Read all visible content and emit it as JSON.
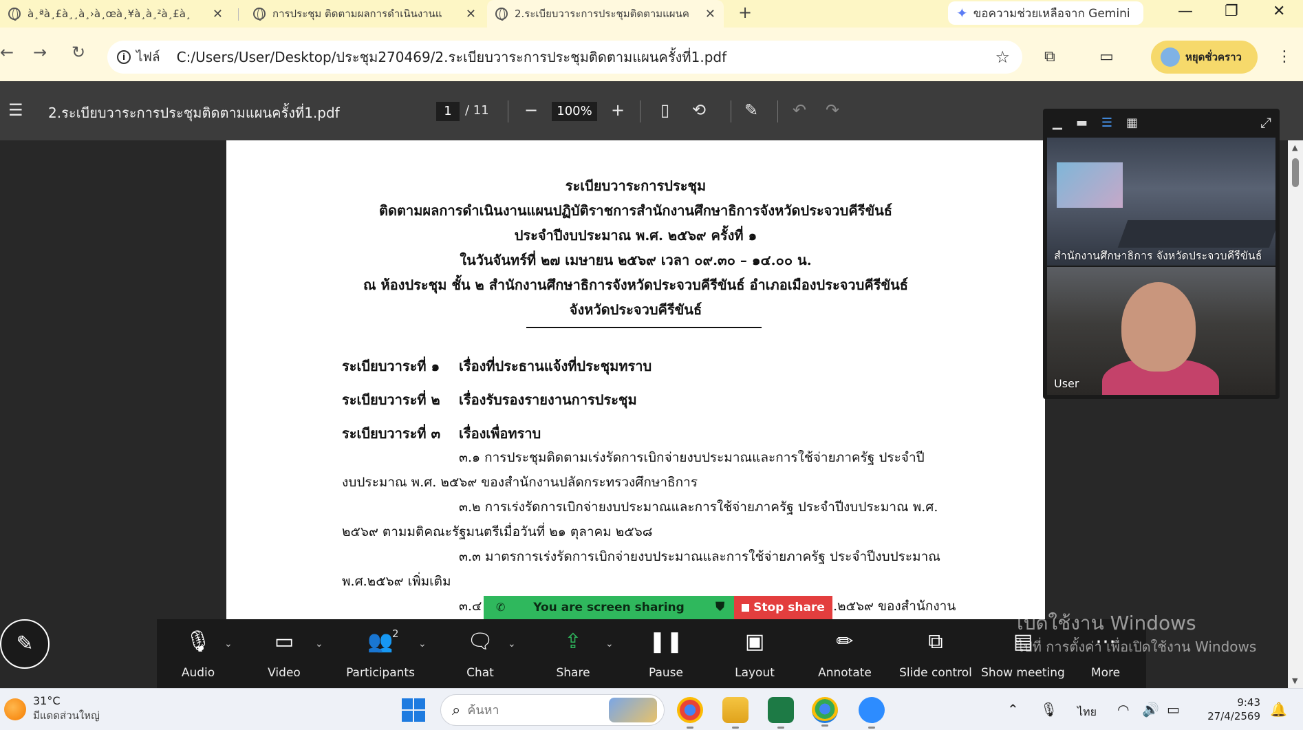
{
  "browser": {
    "tabs": [
      {
        "title": "à¸ªà¸£à¸¸à¸›à¸œà¸¥à¸à¸²à¸£à¸"
      },
      {
        "title": "การประชุม ติดตามผลการดำเนินงานแ"
      },
      {
        "title": "2.ระเบียบวาระการประชุมติดตามแผนค"
      }
    ],
    "gemini_label": "ขอความช่วยเหลือจาก Gemini",
    "address": {
      "chip": "ไฟล์",
      "url": "C:/Users/User/Desktop/ประชุม270469/2.ระเบียบวาระการประชุมติดตามแผนครั้งที่1.pdf"
    },
    "profile_label": "หยุดชั่วคราว"
  },
  "pdf_viewer": {
    "file_name": "2.ระเบียบวาระการประชุมติดตามแผนครั้งที่1.pdf",
    "current_page": "1",
    "total_pages": "/ 11",
    "zoom": "100%"
  },
  "document": {
    "heading_lines": [
      "ระเบียบวาระการประชุม",
      "ติดตามผลการดำเนินงานแผนปฏิบัติราชการสำนักงานศึกษาธิการจังหวัดประจวบคีรีขันธ์",
      "ประจำปีงบประมาณ พ.ศ. ๒๕๖๙ ครั้งที่ ๑",
      "ในวันจันทร์ที่ ๒๗ เมษายน ๒๕๖๙ เวลา ๐๙.๓๐ – ๑๔.๐๐ น.",
      "ณ ห้องประชุม ชั้น ๒ สำนักงานศึกษาธิการจังหวัดประจวบคีรีขันธ์ อำเภอเมืองประจวบคีรีขันธ์",
      "จังหวัดประจวบคีรีขันธ์"
    ],
    "agenda": [
      {
        "label": "ระเบียบวาระที่ ๑",
        "title": "เรื่องที่ประธานแจ้งที่ประชุมทราบ"
      },
      {
        "label": "ระเบียบวาระที่ ๒",
        "title": "เรื่องรับรองรายงานการประชุม"
      },
      {
        "label": "ระเบียบวาระที่ ๓",
        "title": "เรื่องเพื่อทราบ"
      }
    ],
    "body_lines": [
      "๓.๑ การประชุมติดตามเร่งรัดการเบิกจ่ายงบประมาณและการใช้จ่ายภาครัฐ ประจำปี",
      "งบประมาณ พ.ศ. ๒๕๖๙ ของสำนักงานปลัดกระทรวงศึกษาธิการ",
      "๓.๒ การเร่งรัดการเบิกจ่ายงบประมาณและการใช้จ่ายภาครัฐ ประจำปีงบประมาณ พ.ศ.",
      "๒๕๖๙ ตามมติคณะรัฐมนตรีเมื่อวันที่ ๒๑ ตุลาคม ๒๕๖๘",
      "๓.๓ มาตรการเร่งรัดการเบิกจ่ายงบประมาณและการใช้จ่ายภาครัฐ ประจำปีงบประมาณ",
      "พ.ศ.๒๕๖๙ เพิ่มเติม",
      "๓.๔",
      ".๒๕๖๙ ของสำนักงาน"
    ]
  },
  "zoom": {
    "participants": [
      {
        "name": "สำนักงานศึกษาธิการ จังหวัดประจวบคีรีขันธ์"
      },
      {
        "name": "User"
      }
    ],
    "share_banner": {
      "status": "You are screen sharing",
      "stop_label": "Stop share"
    },
    "controls": [
      {
        "label": "Audio"
      },
      {
        "label": "Video"
      },
      {
        "label": "Participants",
        "count": "2"
      },
      {
        "label": "Chat"
      },
      {
        "label": "Share"
      },
      {
        "label": "Pause"
      },
      {
        "label": "Layout"
      },
      {
        "label": "Annotate"
      },
      {
        "label": "Slide control"
      },
      {
        "label": "Show meeting"
      },
      {
        "label": "More"
      }
    ],
    "share_accent": "#2fb85d",
    "stop_accent": "#e33e3e"
  },
  "watermark": {
    "line1": "เปิดใช้งาน Windows",
    "line2": "ไปที่ การตั้งค่า เพื่อเปิดใช้งาน Windows"
  },
  "taskbar": {
    "weather_temp": "31°C",
    "weather_desc": "มีแดดส่วนใหญ่",
    "search_placeholder": "ค้นหา",
    "language": "ไทย",
    "time": "9:43",
    "date": "27/4/2569"
  }
}
